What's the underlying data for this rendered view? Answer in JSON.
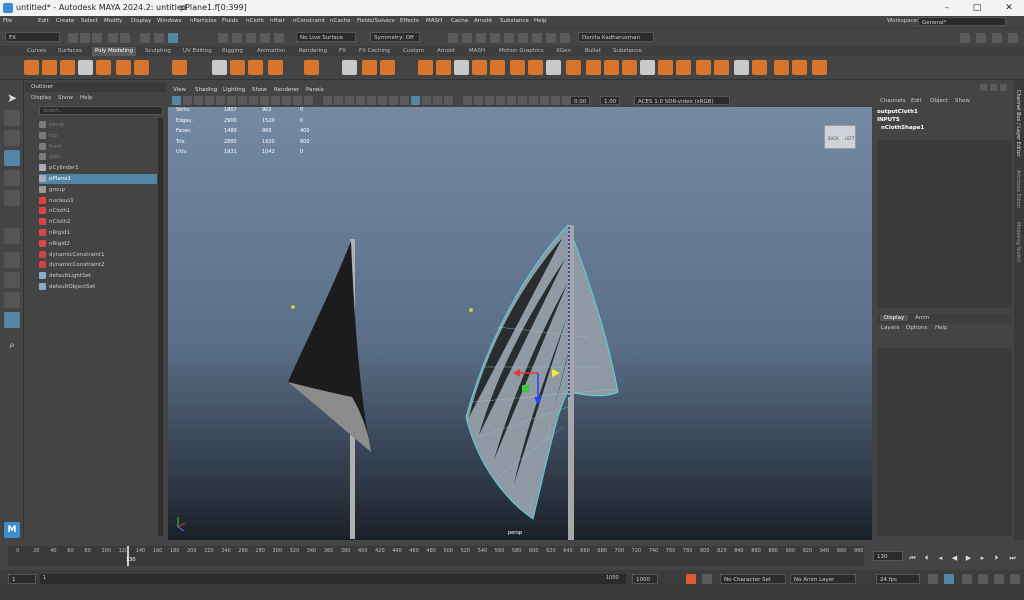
{
  "window": {
    "title": "untitled* - Autodesk MAYA 2024.2: untitled",
    "sep": "---",
    "file": "pPlane1.f[0:399]"
  },
  "menu": [
    "File",
    "Edit",
    "Create",
    "Select",
    "Modify",
    "Display",
    "Windows",
    "nParticles",
    "Fluids",
    "nCloth",
    "nHair",
    "nConstraint",
    "nCache",
    "Fields/Solvers",
    "Effects",
    "MASH",
    "Cache",
    "Arnold",
    "Substance",
    "Help"
  ],
  "workspace": {
    "label": "Workspace:",
    "value": "General*"
  },
  "status": {
    "menuset": "FX",
    "live_surface": "No Live Surface",
    "symmetry": "Symmetry: Off",
    "user": "Donita Kadharusman"
  },
  "shelf_tabs": [
    "Curves",
    "Surfaces",
    "Poly Modeling",
    "Sculpting",
    "UV Editing",
    "Rigging",
    "Animation",
    "Rendering",
    "FX",
    "FX Caching",
    "Custom",
    "Arnold",
    "MASH",
    "Motion Graphics",
    "XGen",
    "Bullet",
    "Substance"
  ],
  "shelf_active": "Poly Modeling",
  "outliner": {
    "title": "Outliner",
    "menus": [
      "Display",
      "Show",
      "Help"
    ],
    "search_placeholder": "Search...",
    "items": [
      "persp",
      "top",
      "front",
      "side",
      "pCylinder1",
      "pPlane1",
      "group",
      "nucleus1",
      "nCloth1",
      "nCloth2",
      "nRigid1",
      "nRigid2",
      "dynamicConstraint1",
      "dynamicConstraint2",
      "defaultLightSet",
      "defaultObjectSet"
    ]
  },
  "viewport": {
    "menus": [
      "View",
      "Shading",
      "Lighting",
      "Show",
      "Renderer",
      "Panels"
    ],
    "exposure": "0.00",
    "gamma": "1.00",
    "colorspace": "ACES 1.0 SDR-video (sRGB)",
    "camera": "persp",
    "viewcube": [
      "BACK",
      "LEFT"
    ],
    "hud": [
      {
        "label": "Verts:",
        "a": "1807",
        "b": "902",
        "c": "0"
      },
      {
        "label": "Edges:",
        "a": "2900",
        "b": "1520",
        "c": "0"
      },
      {
        "label": "Faces:",
        "a": "1480",
        "b": "960",
        "c": "400"
      },
      {
        "label": "Tris:",
        "a": "2880",
        "b": "1920",
        "c": "800"
      },
      {
        "label": "UVs:",
        "a": "1931",
        "b": "1042",
        "c": "0"
      }
    ]
  },
  "channelbox": {
    "menus": [
      "Channels",
      "Edit",
      "Object",
      "Show"
    ],
    "object": "outputCloth1",
    "inputs": "INPUTS",
    "input_node": "nClothShape1",
    "layer_tabs": [
      "Display",
      "Anim"
    ],
    "layer_menus": [
      "Layers",
      "Options",
      "Help"
    ],
    "side_tabs": [
      "Channel Box / Layer Editor",
      "Attribute Editor",
      "Modeling Toolkit"
    ]
  },
  "timeline": {
    "ticks": [
      "0",
      "20",
      "40",
      "60",
      "80",
      "100",
      "120",
      "140",
      "160",
      "180",
      "200",
      "220",
      "240",
      "260",
      "280",
      "300",
      "320",
      "340",
      "360",
      "380",
      "400",
      "420",
      "440",
      "460",
      "480",
      "500",
      "520",
      "540",
      "560",
      "580",
      "600",
      "620",
      "640",
      "660",
      "680",
      "700",
      "720",
      "740",
      "760",
      "780",
      "800",
      "820",
      "840",
      "860",
      "880",
      "900",
      "920",
      "940",
      "960",
      "980"
    ],
    "current": "130",
    "current_field": "130",
    "range_start": "1",
    "range_inner_start": "1",
    "range_inner_end": "1000",
    "range_end": "1000",
    "character_set": "No Character Set",
    "anim_layer": "No Anim Layer",
    "fps": "24 fps"
  },
  "colors": {
    "accent": "#e8873a",
    "selected": "#5285a6",
    "shelf_icon": "#d9742c"
  }
}
